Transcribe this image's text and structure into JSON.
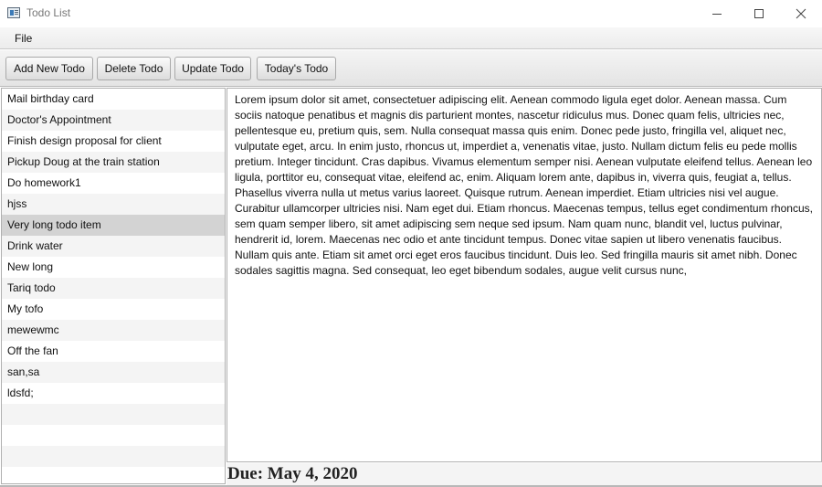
{
  "window": {
    "title": "Todo List",
    "icon": "app-window-icon",
    "controls": [
      "minimize-icon",
      "maximize-icon",
      "close-icon"
    ]
  },
  "menubar": {
    "file_label": "File"
  },
  "toolbar": {
    "add_label": "Add New Todo",
    "delete_label": "Delete Todo",
    "update_label": "Update Todo",
    "today_label": "Today's Todo"
  },
  "todos": {
    "items": [
      "Mail birthday card",
      "Doctor's Appointment",
      "Finish design proposal for client",
      "Pickup Doug at the train station",
      "Do homework1",
      "hjss",
      "Very long todo item",
      "Drink water",
      "New long",
      "Tariq todo",
      "My tofo",
      "mewewmc",
      "Off the fan",
      "san,sa",
      "ldsfd;"
    ],
    "selected_index": 6
  },
  "detail": {
    "text": "Lorem ipsum dolor sit amet, consectetuer adipiscing elit. Aenean commodo ligula eget dolor. Aenean massa. Cum sociis natoque penatibus et magnis dis parturient montes, nascetur ridiculus mus. Donec quam felis, ultricies nec, pellentesque eu, pretium quis, sem. Nulla consequat massa quis enim. Donec pede justo, fringilla vel, aliquet nec, vulputate eget, arcu. In enim justo, rhoncus ut, imperdiet a, venenatis vitae, justo. Nullam dictum felis eu pede mollis pretium. Integer tincidunt. Cras dapibus. Vivamus elementum semper nisi. Aenean vulputate eleifend tellus. Aenean leo ligula, porttitor eu, consequat vitae, eleifend ac, enim. Aliquam lorem ante, dapibus in, viverra quis, feugiat a, tellus. Phasellus viverra nulla ut metus varius laoreet. Quisque rutrum. Aenean imperdiet. Etiam ultricies nisi vel augue. Curabitur ullamcorper ultricies nisi. Nam eget dui. Etiam rhoncus. Maecenas tempus, tellus eget condimentum rhoncus, sem quam semper libero, sit amet adipiscing sem neque sed ipsum. Nam quam nunc, blandit vel, luctus pulvinar, hendrerit id, lorem. Maecenas nec odio et ante tincidunt tempus. Donec vitae sapien ut libero venenatis faucibus. Nullam quis ante. Etiam sit amet orci eget eros faucibus tincidunt. Duis leo. Sed fringilla mauris sit amet nibh. Donec sodales sagittis magna. Sed consequat, leo eget bibendum sodales, augue velit cursus nunc,"
  },
  "due": {
    "label": "Due: May 4, 2020"
  },
  "colors": {
    "selected_row": "#d3d3d3",
    "alt_row": "#f4f4f4",
    "border": "#b0b0b0"
  }
}
